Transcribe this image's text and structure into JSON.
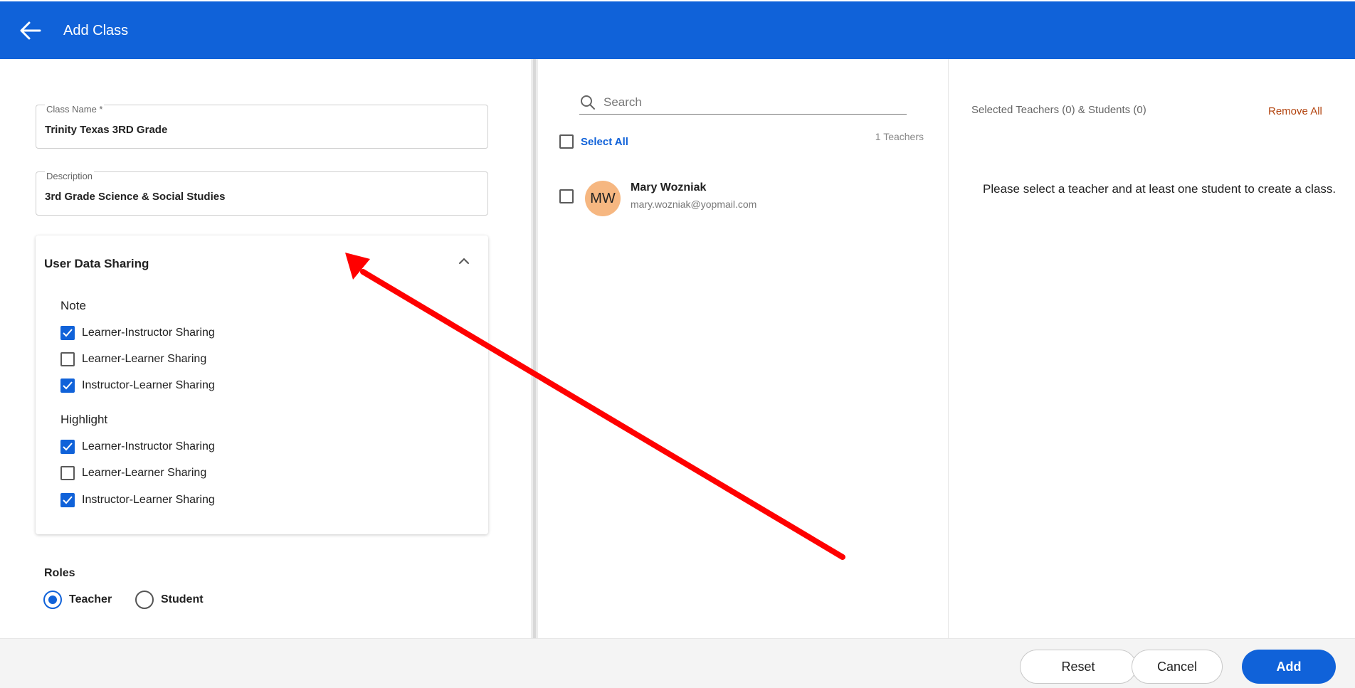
{
  "header": {
    "title": "Add Class",
    "back_icon": "arrow-left-icon"
  },
  "form": {
    "class_name": {
      "label": "Class Name *",
      "value": "Trinity Texas 3RD Grade"
    },
    "description": {
      "label": "Description",
      "value": "3rd Grade Science & Social Studies"
    },
    "sharing": {
      "title": "User Data Sharing",
      "collapse_icon": "chevron-up-icon",
      "groups": [
        {
          "title": "Note",
          "options": [
            {
              "label": "Learner-Instructor Sharing",
              "checked": true
            },
            {
              "label": "Learner-Learner Sharing",
              "checked": false
            },
            {
              "label": "Instructor-Learner Sharing",
              "checked": true
            }
          ]
        },
        {
          "title": "Highlight",
          "options": [
            {
              "label": "Learner-Instructor Sharing",
              "checked": true
            },
            {
              "label": "Learner-Learner Sharing",
              "checked": false
            },
            {
              "label": "Instructor-Learner Sharing",
              "checked": true
            }
          ]
        }
      ]
    },
    "roles": {
      "label": "Roles",
      "options": [
        {
          "label": "Teacher",
          "selected": true
        },
        {
          "label": "Student",
          "selected": false
        }
      ]
    }
  },
  "people": {
    "search_placeholder": "Search",
    "select_all_label": "Select All",
    "count_label": "1 Teachers",
    "list": [
      {
        "initials": "MW",
        "name": "Mary Wozniak",
        "email": "mary.wozniak@yopmail.com",
        "checked": false,
        "avatar_color": "#f6b781"
      }
    ]
  },
  "selection": {
    "title": "Selected Teachers (0) & Students (0)",
    "remove_all_label": "Remove All",
    "hint": "Please select a teacher and at least one student to create a class."
  },
  "footer": {
    "reset_label": "Reset",
    "cancel_label": "Cancel",
    "add_label": "Add"
  },
  "colors": {
    "primary": "#1062d9",
    "danger_link": "#b2420c",
    "annotation_arrow": "#ff0000"
  }
}
